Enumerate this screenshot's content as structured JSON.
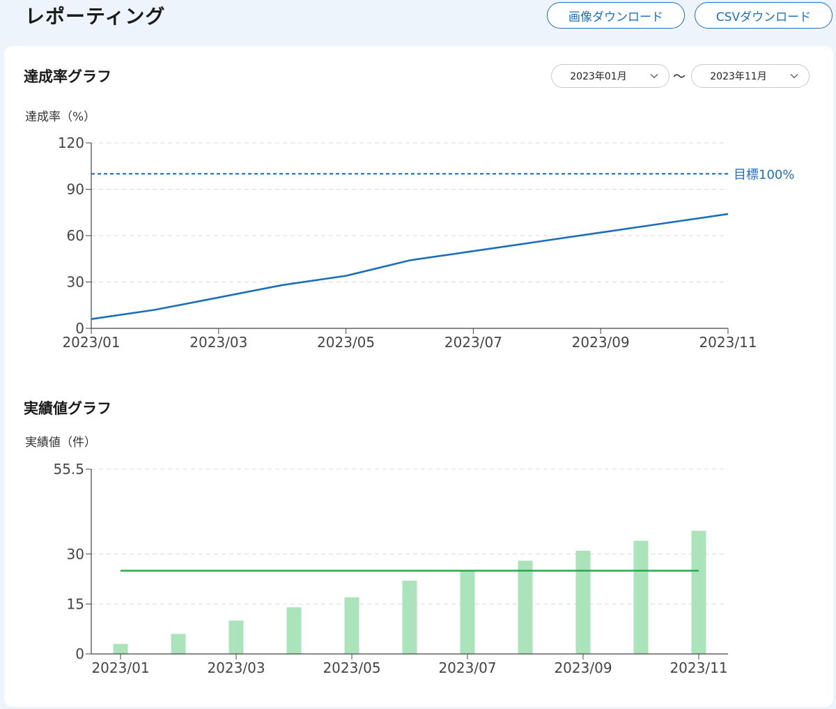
{
  "header": {
    "title": "レポーティング",
    "image_download_label": "画像ダウンロード",
    "csv_download_label": "CSVダウンロード"
  },
  "colors": {
    "accent": "#1e6fc0",
    "line_series": "#1a6fb8",
    "bar_fill": "#abe3bb",
    "avg_line": "#29a847",
    "grid": "#d9d9d9"
  },
  "achievement": {
    "title": "達成率グラフ",
    "range_start": "2023年01月",
    "range_separator": "〜",
    "range_end": "2023年11月",
    "target_label": "目標100%"
  },
  "results": {
    "title": "実績値グラフ"
  },
  "chart_data": [
    {
      "type": "line",
      "title": "達成率グラフ",
      "ylabel": "達成率（%）",
      "x": [
        "2023/01",
        "2023/02",
        "2023/03",
        "2023/04",
        "2023/05",
        "2023/06",
        "2023/07",
        "2023/08",
        "2023/09",
        "2023/10",
        "2023/11"
      ],
      "x_tick_labels": [
        "2023/01",
        "2023/03",
        "2023/05",
        "2023/07",
        "2023/09",
        "2023/11"
      ],
      "series": [
        {
          "values": [
            6,
            12,
            20,
            28,
            34,
            44,
            50,
            56,
            62,
            68,
            74
          ]
        }
      ],
      "target": 100,
      "target_label": "目標100%",
      "ylim": [
        0,
        120
      ],
      "yticks": [
        0,
        30,
        60,
        90,
        120
      ],
      "grid": true
    },
    {
      "type": "bar",
      "title": "実績値グラフ",
      "ylabel": "実績値（件）",
      "categories": [
        "2023/01",
        "2023/02",
        "2023/03",
        "2023/04",
        "2023/05",
        "2023/06",
        "2023/07",
        "2023/08",
        "2023/09",
        "2023/10",
        "2023/11"
      ],
      "x_tick_labels": [
        "2023/01",
        "2023/03",
        "2023/05",
        "2023/07",
        "2023/09",
        "2023/11"
      ],
      "values": [
        3,
        6,
        10,
        14,
        17,
        22,
        25,
        28,
        31,
        34,
        37
      ],
      "average_line": 25,
      "ylim": [
        0,
        55.5
      ],
      "yticks": [
        0,
        15,
        30,
        55.5
      ],
      "grid": true
    }
  ]
}
